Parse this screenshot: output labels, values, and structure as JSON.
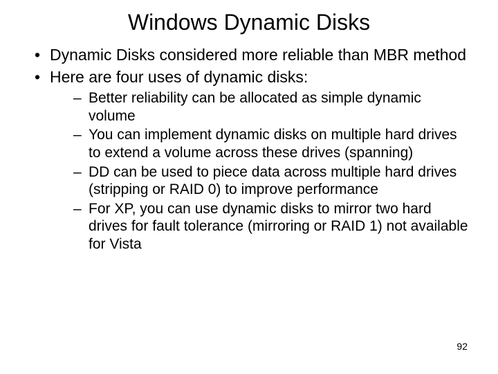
{
  "title": "Windows Dynamic Disks",
  "bullets": [
    {
      "text": "Dynamic Disks considered more reliable than MBR method"
    },
    {
      "text": "Here are four uses of dynamic disks:"
    }
  ],
  "sub_bullets": [
    {
      "text": "Better reliability can be allocated as simple dynamic volume"
    },
    {
      "text": "You can implement dynamic disks on multiple hard drives to extend a volume across these drives (spanning)"
    },
    {
      "text": "DD can be used to piece data across multiple hard drives (stripping or RAID 0) to improve performance"
    },
    {
      "text": "For XP, you can use dynamic disks to mirror two hard drives for fault tolerance (mirroring or RAID 1) not available for Vista"
    }
  ],
  "page_number": "92"
}
